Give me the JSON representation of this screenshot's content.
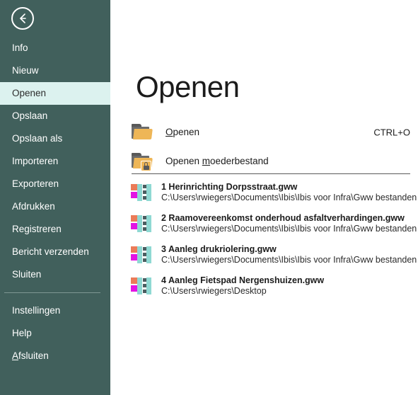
{
  "sidebar": {
    "back_button": {
      "icon": "arrow-left-icon",
      "label": "Terug"
    },
    "background_color": "#41605c",
    "selected_background_color": "#dcf2ef",
    "items": [
      {
        "label": "Info",
        "accel": "",
        "selected": false,
        "divider_before": false
      },
      {
        "label": "Nieuw",
        "accel": "",
        "selected": false,
        "divider_before": false
      },
      {
        "label": "Openen",
        "accel": "",
        "selected": true,
        "divider_before": false
      },
      {
        "label": "Opslaan",
        "accel": "",
        "selected": false,
        "divider_before": false
      },
      {
        "label": "Opslaan als",
        "accel": "",
        "selected": false,
        "divider_before": false
      },
      {
        "label": "Importeren",
        "accel": "",
        "selected": false,
        "divider_before": false
      },
      {
        "label": "Exporteren",
        "accel": "",
        "selected": false,
        "divider_before": false
      },
      {
        "label": "Afdrukken",
        "accel": "",
        "selected": false,
        "divider_before": false
      },
      {
        "label": "Registreren",
        "accel": "",
        "selected": false,
        "divider_before": false
      },
      {
        "label": "Bericht verzenden",
        "accel": "",
        "selected": false,
        "divider_before": false
      },
      {
        "label": "Sluiten",
        "accel": "",
        "selected": false,
        "divider_before": false
      },
      {
        "label": "Instellingen",
        "accel": "",
        "selected": false,
        "divider_before": true
      },
      {
        "label": "Help",
        "accel": "",
        "selected": false,
        "divider_before": false
      },
      {
        "label": "Afsluiten",
        "accel": "A",
        "selected": false,
        "divider_before": false
      }
    ]
  },
  "main": {
    "title": "Openen",
    "actions": [
      {
        "icon": "folder-icon",
        "label_before": "",
        "label_accel": "O",
        "label_after": "penen",
        "shortcut": "CTRL+O"
      },
      {
        "icon": "folder-lock-icon",
        "label_before": "Openen ",
        "label_accel": "m",
        "label_after": "oederbestand",
        "shortcut": ""
      }
    ],
    "recent_files": [
      {
        "icon": "gww-file-icon",
        "name": "1 Herinrichting Dorpsstraat.gww",
        "path": "C:\\Users\\rwiegers\\Documents\\Ibis\\Ibis voor Infra\\Gww bestanden"
      },
      {
        "icon": "gww-file-icon",
        "name": "2 Raamovereenkomst onderhoud asfaltverhardingen.gww",
        "path": "C:\\Users\\rwiegers\\Documents\\Ibis\\Ibis voor Infra\\Gww bestanden"
      },
      {
        "icon": "gww-file-icon",
        "name": "3 Aanleg drukriolering.gww",
        "path": "C:\\Users\\rwiegers\\Documents\\Ibis\\Ibis voor Infra\\Gww bestanden"
      },
      {
        "icon": "gww-file-icon",
        "name": "4 Aanleg Fietspad Nergenshuizen.gww",
        "path": "C:\\Users\\rwiegers\\Desktop"
      }
    ]
  },
  "colors": {
    "sidebar_bg": "#41605c",
    "sidebar_selected_bg": "#dcf2ef",
    "folder_accent": "#eeb657",
    "file_icon_teal": "#8fd9d3",
    "file_icon_orange": "#eb7b58",
    "file_icon_magenta": "#e313e3",
    "text_dark": "#1b1b1b"
  }
}
